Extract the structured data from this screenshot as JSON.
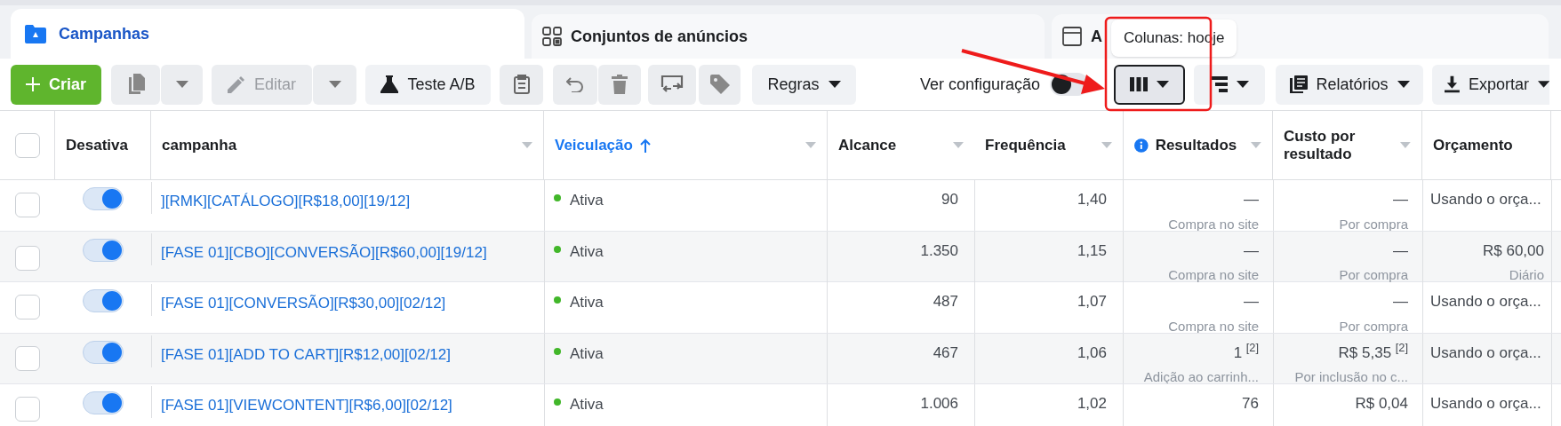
{
  "tabs": [
    {
      "label": "Campanhas",
      "selected": true
    },
    {
      "label": "Conjuntos de anúncios",
      "selected": false
    },
    {
      "label": "A",
      "selected": false
    }
  ],
  "tooltip": "Colunas: hooje",
  "toolbar": {
    "create": "Criar",
    "edit": {
      "label": "Editar",
      "disabled": true
    },
    "ab_test": "Teste A/B",
    "rules": "Regras",
    "view_config": {
      "label": "Ver configuração",
      "on": false
    },
    "reports": "Relatórios",
    "export": "Exportar"
  },
  "select_all": {
    "checked": false
  },
  "columns": [
    {
      "label": "Desativa",
      "sorted": false,
      "kind": "plain"
    },
    {
      "label": "campanha",
      "sorted": false,
      "kind": "menu"
    },
    {
      "label": "Veiculação",
      "sorted": true,
      "kind": "menu"
    },
    {
      "label": "Alcance",
      "sorted": false,
      "kind": "menu"
    },
    {
      "label": "Frequência",
      "sorted": false,
      "kind": "menu"
    },
    {
      "label": "Resultados",
      "sorted": false,
      "kind": "info"
    },
    {
      "label": "Custo por resultado",
      "sorted": false,
      "kind": "menu"
    },
    {
      "label": "Orçamento",
      "sorted": false,
      "kind": "plain"
    }
  ],
  "rows": [
    {
      "checked": false,
      "on": true,
      "name": "][RMK][CATÁLOGO][R$18,00][19/12]",
      "delivery": {
        "label": "Ativa",
        "color": "#42b72a"
      },
      "reach": "90",
      "frequency": "1,40",
      "results": {
        "value": "—",
        "sub": "Compra no site"
      },
      "cost": {
        "value": "—",
        "sub": "Por compra"
      },
      "budget": {
        "value": "Usando o orça..."
      }
    },
    {
      "checked": false,
      "on": true,
      "name": "[FASE 01][CBO][CONVERSÃO][R$60,00][19/12]",
      "delivery": {
        "label": "Ativa",
        "color": "#42b72a"
      },
      "reach": "1.350",
      "frequency": "1,15",
      "results": {
        "value": "—",
        "sub": "Compra no site"
      },
      "cost": {
        "value": "—",
        "sub": "Por compra"
      },
      "budget": {
        "value": "R$ 60,00",
        "sub": "Diário"
      }
    },
    {
      "checked": false,
      "on": true,
      "name": "[FASE 01][CONVERSÃO][R$30,00][02/12]",
      "delivery": {
        "label": "Ativa",
        "color": "#42b72a"
      },
      "reach": "487",
      "frequency": "1,07",
      "results": {
        "value": "—",
        "sub": "Compra no site"
      },
      "cost": {
        "value": "—",
        "sub": "Por compra"
      },
      "budget": {
        "value": "Usando o orça..."
      }
    },
    {
      "checked": false,
      "on": true,
      "name": "[FASE 01][ADD TO CART][R$12,00][02/12]",
      "delivery": {
        "label": "Ativa",
        "color": "#42b72a"
      },
      "reach": "467",
      "frequency": "1,06",
      "results": {
        "value": "1 $^{[2]}$",
        "sub": "Adição ao carrinh..."
      },
      "cost": {
        "value": "R$ 5,35 $^{[2]}$",
        "sub": "Por inclusão no c..."
      },
      "budget": {
        "value": "Usando o orça..."
      }
    },
    {
      "checked": false,
      "on": true,
      "name": "[FASE 01][VIEWCONTENT][R$6,00][02/12]",
      "delivery": {
        "label": "Ativa",
        "color": "#42b72a"
      },
      "reach": "1.006",
      "frequency": "1,02",
      "results": {
        "value": "76"
      },
      "cost": {
        "value": "R$ 0,04"
      },
      "budget": {
        "value": "Usando o orça..."
      }
    }
  ]
}
